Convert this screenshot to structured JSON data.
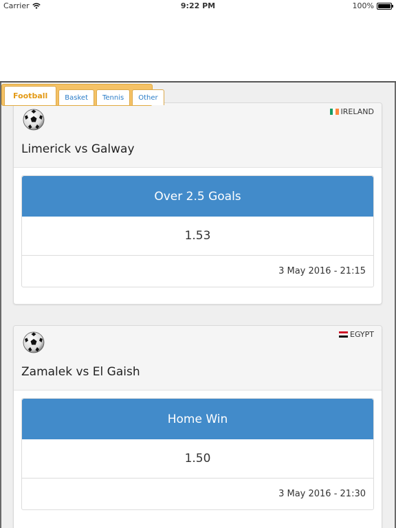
{
  "status_bar": {
    "carrier": "Carrier",
    "time": "9:22 PM",
    "battery": "100%"
  },
  "tabs": [
    {
      "label": "Football",
      "active": true
    },
    {
      "label": "Basket",
      "active": false
    },
    {
      "label": "Tennis",
      "active": false
    },
    {
      "label": "Other",
      "active": false
    }
  ],
  "matches": [
    {
      "sport_icon": "soccer-ball-icon",
      "country": "IRELAND",
      "flag_colors": [
        "#169b62",
        "#ffffff",
        "#ff883e"
      ],
      "title": "Limerick vs Galway",
      "bet_type": "Over 2.5 Goals",
      "odds": "1.53",
      "datetime": "3 May 2016 - 21:15"
    },
    {
      "sport_icon": "soccer-ball-icon",
      "country": "EGYPT",
      "flag_colors": [
        "#ce1126",
        "#ffffff",
        "#000000"
      ],
      "title": "Zamalek vs El Gaish",
      "bet_type": "Home Win",
      "odds": "1.50",
      "datetime": "3 May 2016 - 21:30"
    }
  ],
  "colors": {
    "accent_blue": "#428bca",
    "tab_bar": "#f5c266",
    "tab_active_text": "#e39a16",
    "tab_text": "#2a7cc7"
  }
}
